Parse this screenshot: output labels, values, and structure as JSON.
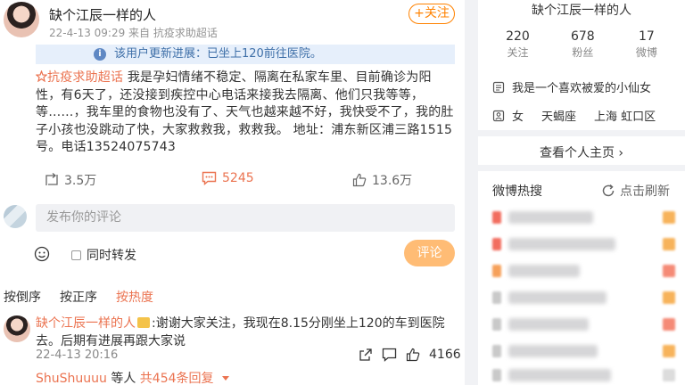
{
  "post": {
    "author": "缺个江辰一样的人",
    "meta": "22-4-13 09:29 来自 抗疫求助超话",
    "follow_label": "+关注",
    "update_notice": "该用户更新进展：已坐上120前往医院。",
    "topic": "抗疫求助超话",
    "body": " 我是孕妇情绪不稳定、隔离在私家车里、目前确诊为阳性，有6天了，还没接到疾控中心电话来接我去隔离、他们只我等等，等……，我车里的食物也没有了、天气也越来越不好，我快受不了，我的肚子小孩也没跳动了快，大家救救我，救救我。    地址：浦东新区浦三路1515号。电话13524075743",
    "repost_count": "3.5万",
    "comment_count": "5245",
    "like_count": "13.6万"
  },
  "composer": {
    "placeholder": "发布你的评论",
    "repost_label": "同时转发",
    "submit_label": "评论"
  },
  "sort_tabs": [
    "按倒序",
    "按正序",
    "按热度"
  ],
  "top_comment": {
    "author": "缺个江辰一样的人",
    "text": "谢谢大家关注，我现在8.15分刚坐上120的车到医院去。后期有进展再跟大家说",
    "time": "22-4-13 20:16",
    "likes": "4166",
    "reply_nick": "ShuShuuuu",
    "reply_mid": " 等人 ",
    "reply_count": "共454条回复"
  },
  "profile": {
    "name": "缺个江辰一样的人",
    "stats": [
      {
        "num": "220",
        "label": "关注"
      },
      {
        "num": "678",
        "label": "粉丝"
      },
      {
        "num": "17",
        "label": "微博"
      }
    ],
    "bio": "我是一个喜欢被爱的小仙女",
    "gender": "女",
    "zodiac": "天蝎座",
    "location": "上海 虹口区",
    "home_link": "查看个人主页 ›"
  },
  "hot": {
    "title": "微博热搜",
    "refresh_label": "点击刷新"
  },
  "colors": {
    "accent": "#eb7350",
    "follow": "#ff8200",
    "notice_bg": "#e6effb"
  }
}
